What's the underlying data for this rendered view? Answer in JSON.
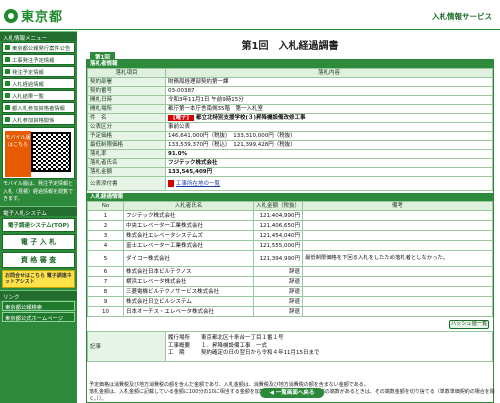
{
  "header": {
    "logo_text": "東京都",
    "service_title": "入札情報サービス"
  },
  "sidebar": {
    "section1": "入札情報メニュー",
    "items": [
      "東京都公報発行案件公告",
      "工事発注予定情報",
      "発注予定情報",
      "入札経過情報",
      "入札結果一覧",
      "都入札参加資格者情報",
      "入札参加資格関係"
    ],
    "mobile_badge": "モバイル版 はこちら",
    "mobile_note": "モバイル版は、発注予定情報と入札（見積）経過情報を閲覧できます。",
    "section2": "電子入札システム",
    "banner1": "電子調達システム(TOP)",
    "banner2": "電 子 入 札",
    "banner3": "資 格 審 査",
    "banner_yellow": "お問合せはこちら 電子調達ネットアシスト",
    "section3": "リンク",
    "links": [
      "東京都公報検索",
      "東京都公式ホームページ"
    ]
  },
  "main": {
    "page_title": "第1回　入札経過調書",
    "tab": "第1回",
    "section_info": "落札者情報",
    "col_item": "落札項目",
    "col_content": "落札内容",
    "rows": [
      {
        "label": "契約部署",
        "value": "財務局経理部契約第一課"
      },
      {
        "label": "契約番号",
        "value": "03-00387"
      },
      {
        "label": "開札日時",
        "value": "令和3年11月1日 午前9時15分"
      },
      {
        "label": "開札場所",
        "value": "都庁第一本庁舎南側35階　第一入札室"
      },
      {
        "label": "件　名",
        "tag": "【電子】",
        "value": "都立北特別支援学校(３)昇降機設備改修工事"
      },
      {
        "label": "公表区分",
        "value": "事前公表"
      },
      {
        "label": "予定価格",
        "value": "146,641,000円（税抜）　133,310,000円（税抜）"
      },
      {
        "label": "最低制限価格",
        "value": "133,539,370円（税込）　121,399,428円（税抜）"
      },
      {
        "label": "落札率",
        "value": "91.0%"
      },
      {
        "label": "落札者氏名",
        "value": "フジテック株式会社"
      },
      {
        "label": "落札金額",
        "value": "133,545,409円"
      },
      {
        "label": "公表添付書",
        "value": "工事所在地の一覧"
      }
    ],
    "section_bid": "入札経過情報",
    "bid_headers": {
      "no": "No",
      "name": "入札者氏名",
      "amount": "入札金額（税抜）",
      "note": "備考"
    },
    "bidders": [
      {
        "no": "1",
        "name": "フジテック株式会社",
        "amount": "121,404,990円",
        "note": ""
      },
      {
        "no": "2",
        "name": "中央エレベーター工業株式会社",
        "amount": "121,406,650円",
        "note": ""
      },
      {
        "no": "3",
        "name": "株式会社エレベータシステムズ",
        "amount": "121,454,040円",
        "note": ""
      },
      {
        "no": "4",
        "name": "富士エレベーター工業株式会社",
        "amount": "121,555,000円",
        "note": ""
      },
      {
        "no": "5",
        "name": "ダイコー株式会社",
        "amount": "121,394,990円",
        "note": "最低制限価格を下回る入札をしたため落札者としなかった。"
      },
      {
        "no": "6",
        "name": "株式会社日本ビルテクノス",
        "amount": "辞退",
        "note": ""
      },
      {
        "no": "7",
        "name": "横浜エレベータ株式会社",
        "amount": "辞退",
        "note": ""
      },
      {
        "no": "8",
        "name": "三菱電機ビルテクノサービス株式会社",
        "amount": "辞退",
        "note": ""
      },
      {
        "no": "9",
        "name": "株式会社日立ビルシステム",
        "amount": "辞退",
        "note": ""
      },
      {
        "no": "10",
        "name": "日本オーチス・エレベータ株式会社",
        "amount": "辞退",
        "note": ""
      }
    ],
    "hash_button": "ハッシュ値一覧",
    "remark_label": "記事",
    "remark_lines": [
      "履行場所　　東京都北区十条台一丁目１番１号",
      "工事概要　　１．昇降機設備工事　一式",
      "工　期　　　契約確定の日の翌日から令和４年11月15日まで"
    ],
    "footnote_lines": [
      "予定価格は消費税及び地方消費税の額を含んだ金額であり、入札金額は、消費税及び地方消費税の額を含まない金額である。",
      "落札金額は、入札金額に記載している金額に100分の10に相当する金額を加算した金額である（１円未満の端数があるときは、その端数金額を切り捨てる（単数単価契約の場合を除く。））。"
    ],
    "back_button": "一覧画面へ戻る"
  }
}
